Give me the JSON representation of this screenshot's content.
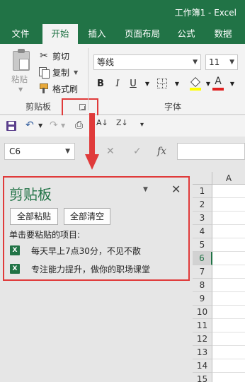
{
  "window": {
    "title": "工作簿1  -  Excel"
  },
  "tabs": [
    {
      "label": "文件"
    },
    {
      "label": "开始"
    },
    {
      "label": "插入"
    },
    {
      "label": "页面布局"
    },
    {
      "label": "公式"
    },
    {
      "label": "数据"
    }
  ],
  "clipboard_group": {
    "paste_label": "粘贴",
    "cut_label": "剪切",
    "copy_label": "复制",
    "format_painter_label": "格式刷",
    "group_label": "剪贴板"
  },
  "font_group": {
    "font_name": "等线",
    "font_size": "11",
    "bold": "B",
    "italic": "I",
    "underline": "U",
    "font_color_glyph": "A",
    "group_label": "字体",
    "fill_color": "#ffff00",
    "font_color": "#e02020"
  },
  "formula_bar": {
    "name_box": "C6",
    "fx": "fx"
  },
  "grid": {
    "column": "A",
    "rows": [
      "1",
      "2",
      "3",
      "4",
      "5",
      "6",
      "7",
      "8",
      "9",
      "10",
      "11",
      "12",
      "13",
      "14",
      "15"
    ],
    "selected_row": "6"
  },
  "clipboard_pane": {
    "title": "剪贴板",
    "paste_all": "全部粘贴",
    "clear_all": "全部清空",
    "hint": "单击要粘贴的项目:",
    "items": [
      {
        "text": "每天早上7点30分，不见不散",
        "icon": "excel-icon"
      },
      {
        "text": "专注能力提升，做你的职场课堂",
        "icon": "excel-icon"
      }
    ]
  },
  "colors": {
    "brand": "#217346",
    "highlight": "#e03a3a"
  }
}
